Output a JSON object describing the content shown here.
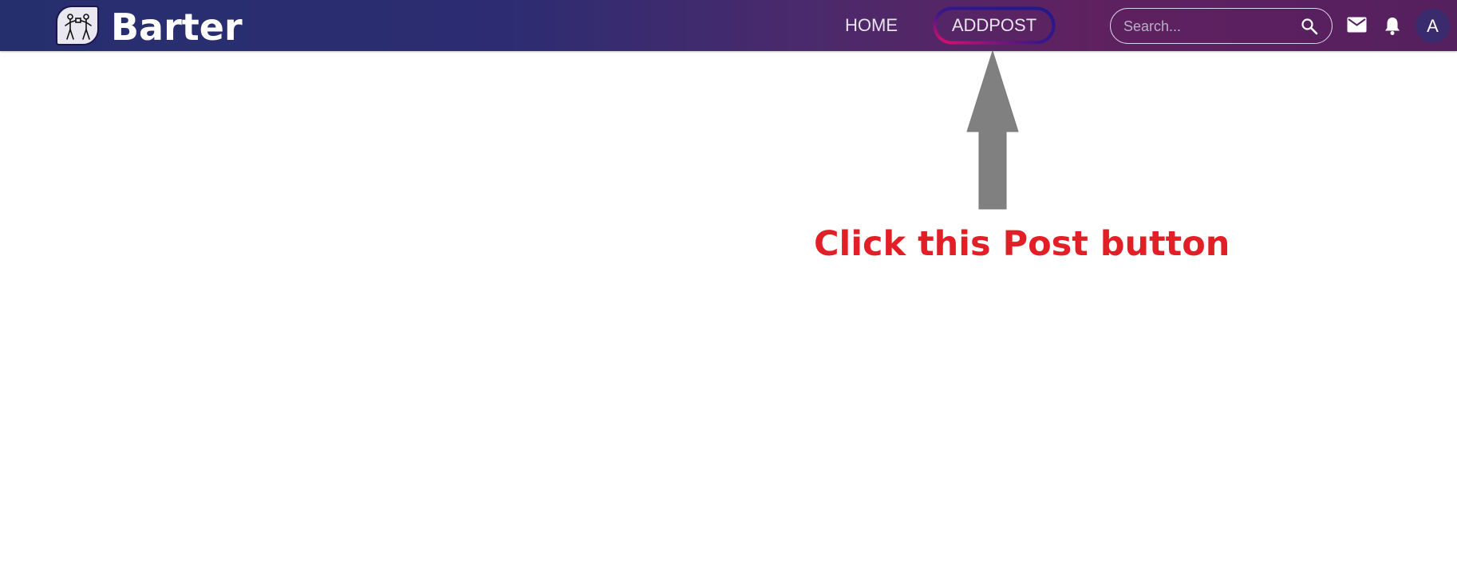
{
  "app": {
    "brand": "Barter",
    "logo_icon": "people-trading-icon"
  },
  "nav": {
    "home_label": "HOME",
    "addpost_label": "ADDPOST"
  },
  "search": {
    "placeholder": "Search...",
    "value": "",
    "icon": "search-icon"
  },
  "actions": {
    "mail_icon": "mail-icon",
    "bell_icon": "bell-icon",
    "avatar_initial": "A"
  },
  "annotation": {
    "arrow_icon": "up-arrow-icon",
    "text": "Click this Post button",
    "text_color": "#e21f26",
    "arrow_color": "#808080"
  },
  "colors": {
    "nav_gradient_start": "#262f6e",
    "nav_gradient_end": "#55205e",
    "highlight_ring_start": "#1d1a8c",
    "highlight_ring_end": "#e0106a"
  }
}
